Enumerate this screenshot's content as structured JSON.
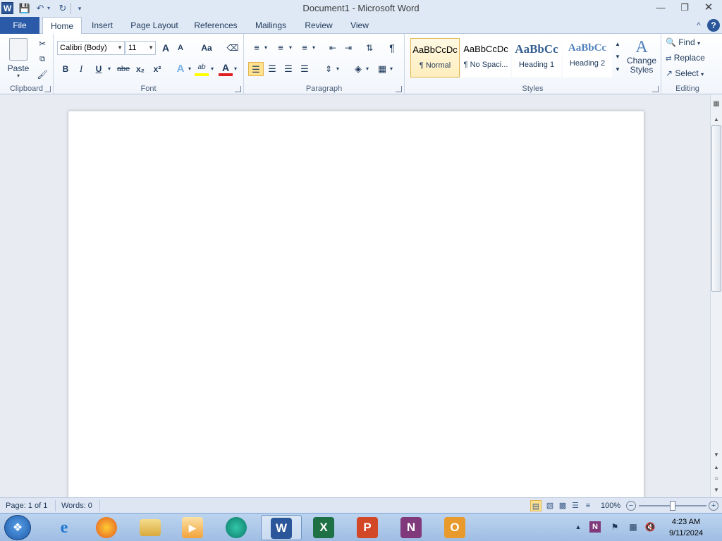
{
  "titlebar": {
    "app_icon": "W",
    "title": "Document1  -  Microsoft Word",
    "icons": [
      "word-app-icon",
      "save-icon",
      "undo-icon",
      "redo-icon",
      "customize-qat-icon",
      "minimize-icon",
      "restore-icon",
      "close-icon"
    ]
  },
  "tabs": {
    "file": "File",
    "items": [
      "Home",
      "Insert",
      "Page Layout",
      "References",
      "Mailings",
      "Review",
      "View"
    ],
    "active": "Home"
  },
  "ribbon": {
    "clipboard": {
      "label": "Clipboard",
      "paste": "Paste"
    },
    "font": {
      "label": "Font",
      "font_name": "Calibri (Body)",
      "font_size": "11",
      "grow": "A",
      "shrink": "A",
      "change_case": "Aa",
      "bold": "B",
      "italic": "I",
      "underline": "U",
      "strikethrough": "abe",
      "subscript": "x₂",
      "superscript": "x²",
      "text_effects": "A",
      "highlight": "ab",
      "font_color": "A"
    },
    "paragraph": {
      "label": "Paragraph",
      "show_marks": "¶"
    },
    "styles": {
      "label": "Styles",
      "gallery": [
        {
          "sample": "AaBbCcDc",
          "name": "¶ Normal"
        },
        {
          "sample": "AaBbCcDc",
          "name": "¶ No Spaci..."
        },
        {
          "sample": "AaBbCc",
          "name": "Heading 1"
        },
        {
          "sample": "AaBbCc",
          "name": "Heading 2"
        }
      ],
      "change_styles": "Change Styles"
    },
    "editing": {
      "label": "Editing",
      "find": "Find",
      "replace": "Replace",
      "select": "Select"
    }
  },
  "statusbar": {
    "page": "Page: 1 of 1",
    "words": "Words: 0",
    "zoom": "100%",
    "zoom_level": 1.0
  },
  "taskbar": {
    "apps": [
      "internet-explorer",
      "firefox",
      "file-explorer",
      "media-player",
      "unknown-app",
      "word",
      "excel",
      "powerpoint",
      "onenote",
      "outlook"
    ],
    "active": "word",
    "time": "4:23 AM",
    "date": "9/11/2024"
  },
  "colors": {
    "file_tab": "#2a5aa8",
    "ribbon_bg": "#ffffff",
    "selected_style_border": "#e3b44b",
    "word_blue": "#2b579a",
    "excel_green": "#1e7145",
    "powerpoint_orange": "#d24726",
    "onenote_purple": "#80397b",
    "outlook_orange": "#e89a2c"
  }
}
